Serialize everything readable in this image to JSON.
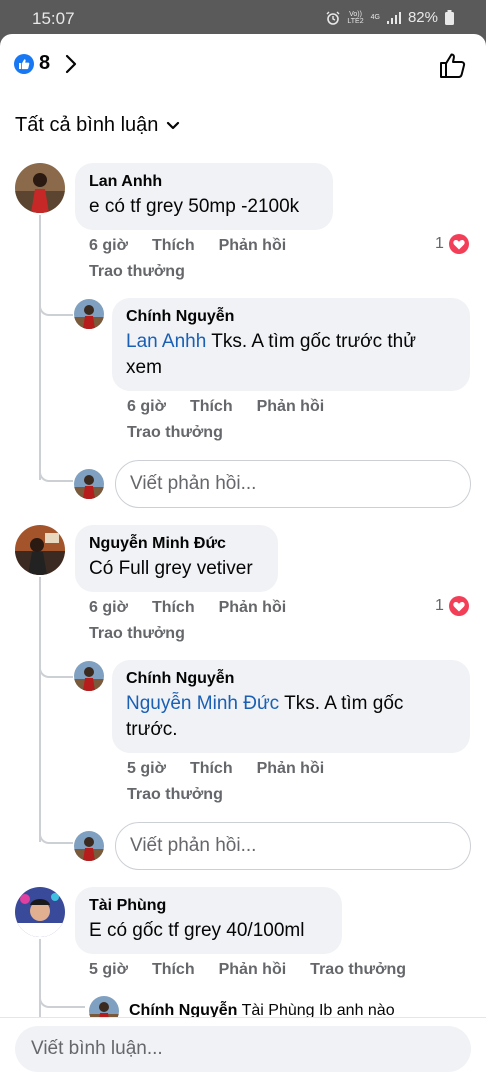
{
  "status_bar": {
    "time": "15:07",
    "volte_top": "Vo))",
    "volte_bottom": "LTE2",
    "network": "4G",
    "battery": "82%"
  },
  "header": {
    "like_count": "8"
  },
  "filter_label": "Tất cả bình luận",
  "comments": [
    {
      "name": "Lan Anhh",
      "text": "e có tf grey 50mp -2100k",
      "time": "6 giờ",
      "like": "Thích",
      "reply": "Phản hồi",
      "award": "Trao thưởng",
      "reaction_count": "1",
      "replies": [
        {
          "name": "Chính Nguyễn",
          "mention": "Lan Anhh",
          "text_line1": "Tks. A tìm gốc trước thử",
          "text_line2": "xem",
          "time": "6 giờ",
          "like": "Thích",
          "reply": "Phản hồi",
          "award": "Trao thưởng"
        }
      ],
      "reply_placeholder": "Viết phản hồi..."
    },
    {
      "name": "Nguyễn Minh Đức",
      "text": "Có Full grey vetiver",
      "time": "6 giờ",
      "like": "Thích",
      "reply": "Phản hồi",
      "award": "Trao thưởng",
      "reaction_count": "1",
      "replies": [
        {
          "name": "Chính Nguyễn",
          "mention": "Nguyễn Minh Đức",
          "text_line1": "Tks. A tìm gốc",
          "text_line2": "trước.",
          "time": "5 giờ",
          "like": "Thích",
          "reply": "Phản hồi",
          "award": "Trao thưởng"
        }
      ],
      "reply_placeholder": "Viết phản hồi..."
    },
    {
      "name": "Tài Phùng",
      "text": "E có gốc tf grey 40/100ml",
      "time": "5 giờ",
      "like": "Thích",
      "reply": "Phản hồi",
      "award": "Trao thưởng",
      "replies": [
        {
          "name": "Chính Nguyễn",
          "preview": "Tài Phùng Ib anh nào"
        }
      ]
    }
  ],
  "comment_placeholder": "Viết bình luận...",
  "colors": {
    "like_blue": "#1877f2",
    "heart_red": "#f33e58",
    "mention_blue": "#1a5fb4",
    "bubble_bg": "#f0f2f5"
  },
  "icons": [
    "like-badge-icon",
    "chevron-right-icon",
    "thumbs-up-outline-icon",
    "chevron-down-icon",
    "heart-reaction-icon",
    "alarm-icon",
    "signal-icon",
    "battery-icon"
  ]
}
